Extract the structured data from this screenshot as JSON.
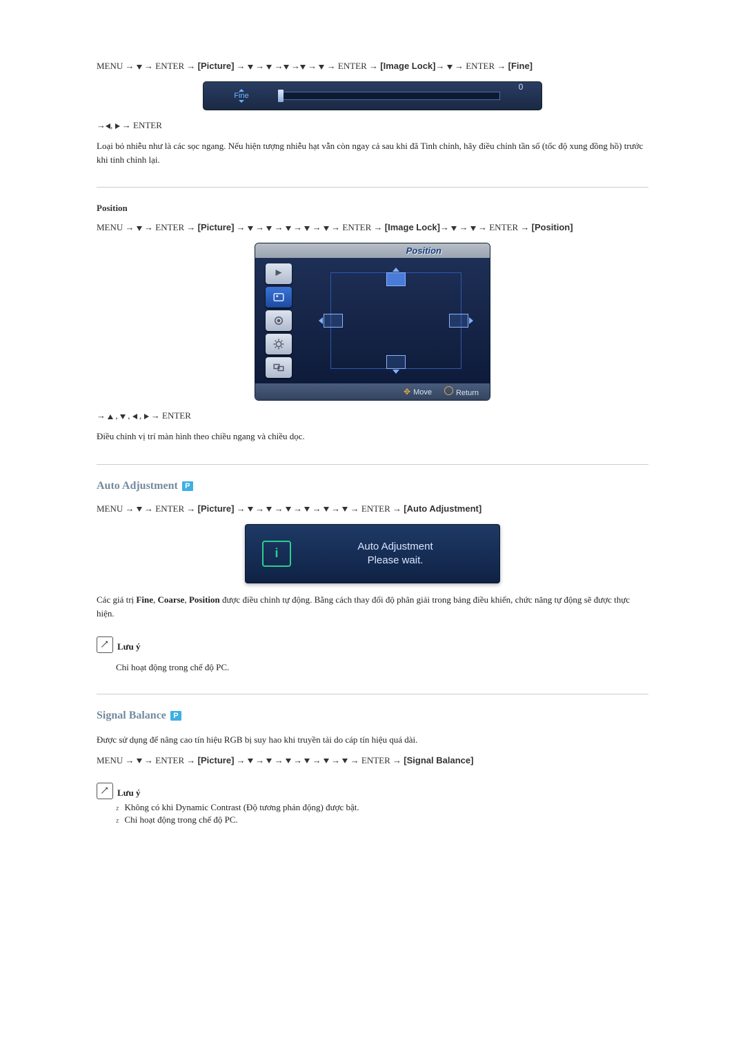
{
  "nav_fine": {
    "pre": "MENU → ",
    "p1": " → ENTER → ",
    "picture": "[Picture]",
    "p2": " → ",
    "p2b": " → ",
    "p2c": " →",
    "p2d": " →",
    "p2e": " → ",
    "p3": " → ENTER → ",
    "imagelock": "[Image Lock]",
    "p4": "→ ",
    "p5": " → ENTER → ",
    "fine": "[Fine]"
  },
  "nav_fine2": {
    "pre": " →",
    "mid": ", ",
    "post": " → ENTER"
  },
  "osd_fine": {
    "label": "Fine",
    "value": "0"
  },
  "body_fine": "Loại bỏ nhiễu như là các sọc ngang. Nếu hiện tượng nhiễu hạt vẫn còn ngay cả sau khi đã Tinh chỉnh, hãy điều chỉnh tần số (tốc độ xung đồng hồ) trước khi tinh chỉnh lại.",
  "pos_heading": "Position",
  "nav_pos": {
    "pre": "MENU → ",
    "p1": " → ENTER → ",
    "picture": "[Picture]",
    "p2": " → ",
    "p3": " → ENTER → ",
    "imagelock": "[Image Lock]",
    "p4": "→ ",
    "p5": " → ENTER → ",
    "position": "[Position]"
  },
  "osd_pos": {
    "title": "Position",
    "move": "Move",
    "ret": "Return"
  },
  "nav_pos2": {
    "pre": " → ",
    "sep": " , ",
    "post": " → ENTER"
  },
  "body_pos": "Điều chỉnh vị trí màn hình theo chiều ngang và chiều dọc.",
  "auto_heading": "Auto Adjustment",
  "nav_auto": {
    "pre": "MENU → ",
    "p1": " → ENTER → ",
    "picture": "[Picture]",
    "p2": " → ",
    "p3": " → ENTER → ",
    "auto": "[Auto Adjustment]"
  },
  "osd_auto": {
    "line1": "Auto Adjustment",
    "line2": "Please wait."
  },
  "body_auto_pre": "Các giá trị ",
  "body_auto_b1": "Fine",
  "body_auto_s1": ", ",
  "body_auto_b2": "Coarse",
  "body_auto_s2": ", ",
  "body_auto_b3": "Position",
  "body_auto_post": " được điều chỉnh tự động. Bằng cách thay đổi độ phân giải trong bảng điều khiển, chức năng tự động sẽ được thực hiện.",
  "note_label": "Lưu ý",
  "note_auto_body": "Chỉ hoạt động trong chế độ PC.",
  "sig_heading": "Signal Balance",
  "body_sig": "Được sử dụng để nâng cao tín hiệu RGB bị suy hao khi truyền tải do cáp tín hiệu quá dài.",
  "nav_sig": {
    "pre": "MENU → ",
    "p1": " → ENTER → ",
    "picture": "[Picture]",
    "p2": " → ",
    "p3": " → ENTER → ",
    "sig": "[Signal Balance]"
  },
  "note_sig_li1": "Không có khi Dynamic Contrast (Độ tương phản động) được bật.",
  "note_sig_li2": "Chỉ hoạt động trong chế độ PC."
}
